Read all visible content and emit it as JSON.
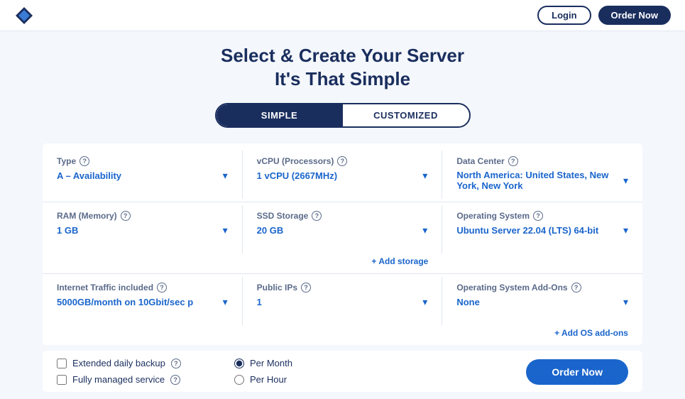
{
  "nav": {
    "login_label": "Login",
    "order_label": "Order Now"
  },
  "page": {
    "title_line1": "Select & Create Your Server",
    "title_line2": "It's That Simple"
  },
  "toggle": {
    "simple_label": "SIMPLE",
    "customized_label": "CUSTOMIZED"
  },
  "form": {
    "type": {
      "label": "Type",
      "value": "A – Availability"
    },
    "vcpu": {
      "label": "vCPU (Processors)",
      "value": "1 vCPU (2667MHz)"
    },
    "datacenter": {
      "label": "Data Center",
      "value": "North America: United States, New York, New York"
    },
    "ram": {
      "label": "RAM (Memory)",
      "value": "1 GB"
    },
    "ssd": {
      "label": "SSD Storage",
      "value": "20 GB"
    },
    "os": {
      "label": "Operating System",
      "value": "Ubuntu Server 22.04 (LTS) 64-bit"
    },
    "add_storage_label": "+ Add storage",
    "internet": {
      "label": "Internet Traffic included",
      "value": "5000GB/month on 10Gbit/sec p"
    },
    "public_ips": {
      "label": "Public IPs",
      "value": "1"
    },
    "os_addons": {
      "label": "Operating System Add-Ons",
      "value": "None"
    },
    "add_os_addons_label": "+ Add OS add-ons"
  },
  "bottom": {
    "checkbox1_label": "Extended daily backup",
    "checkbox2_label": "Fully managed service",
    "radio1_label": "Per Month",
    "radio2_label": "Per Hour",
    "order_btn_label": "Order Now"
  }
}
